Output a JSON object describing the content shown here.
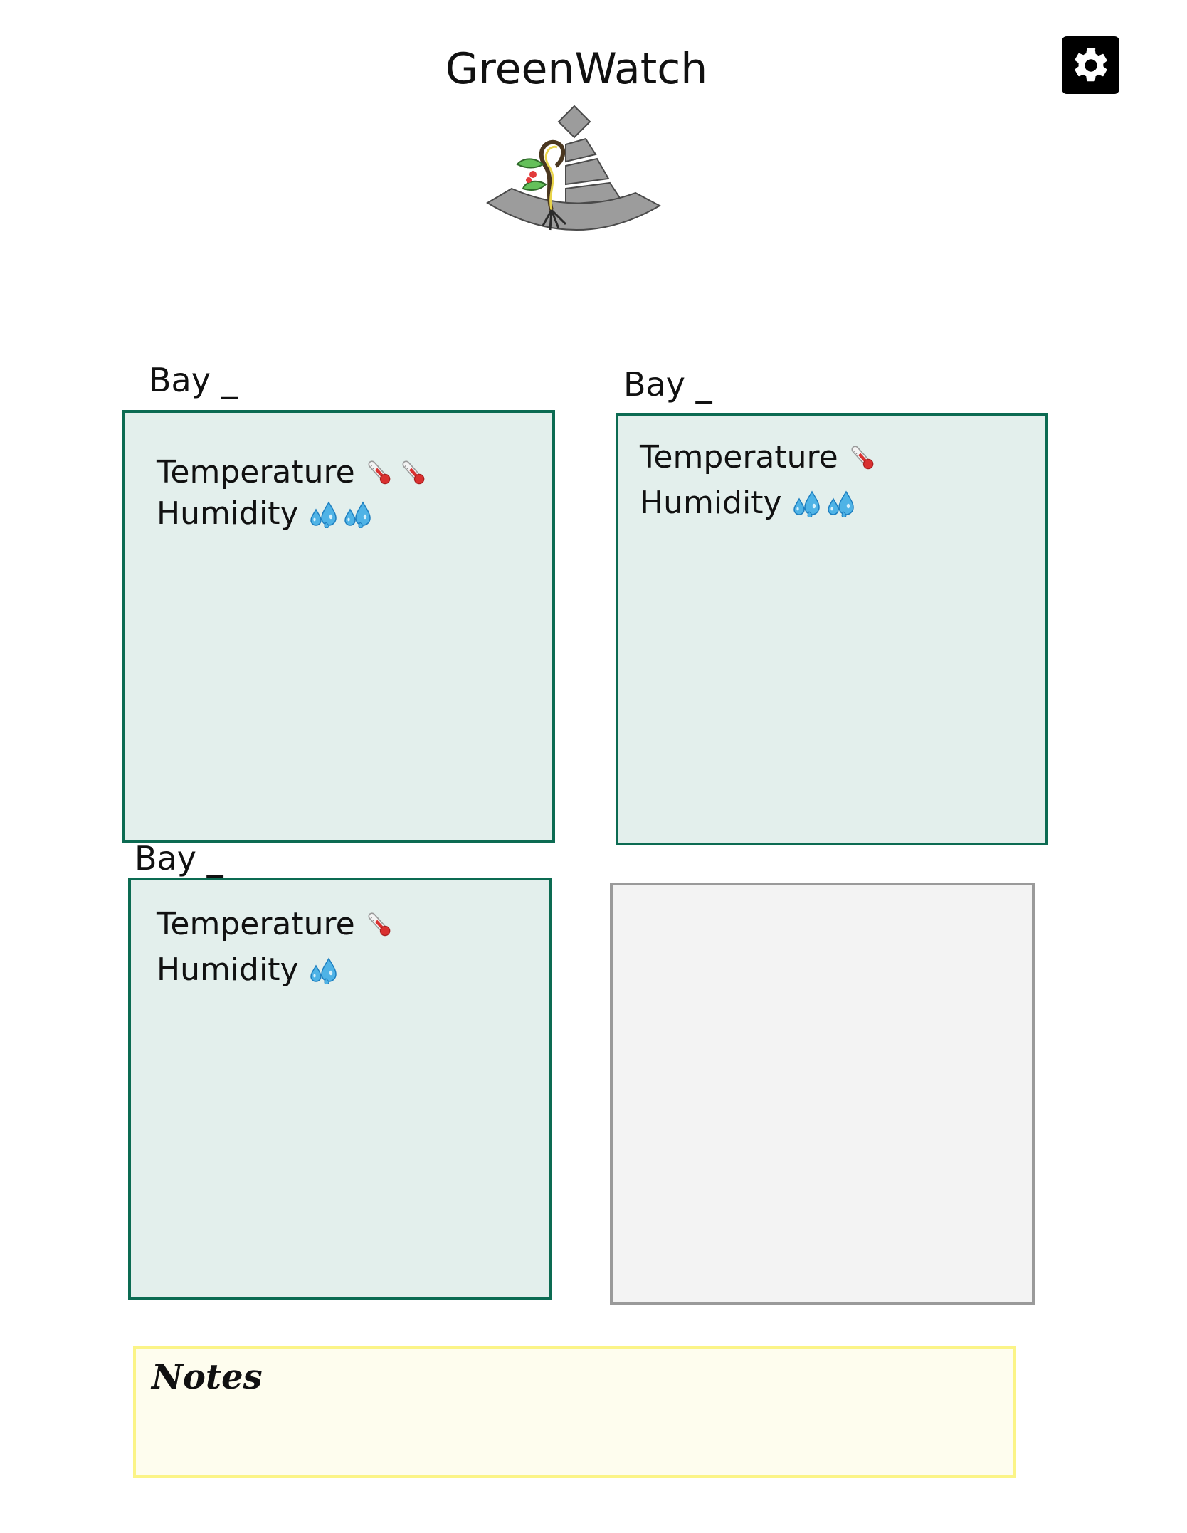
{
  "app": {
    "title": "GreenWatch"
  },
  "header": {
    "settings_icon": "gear-icon",
    "logo": "greenwatch-plant-logo"
  },
  "bays": [
    {
      "label": "Bay _",
      "temperature_label": "Temperature",
      "temperature_icon_count": 2,
      "humidity_label": "Humidity",
      "humidity_icon_count": 2
    },
    {
      "label": "Bay _",
      "temperature_label": "Temperature",
      "temperature_icon_count": 1,
      "humidity_label": "Humidity",
      "humidity_icon_count": 2
    },
    {
      "label": "Bay _",
      "temperature_label": "Temperature",
      "temperature_icon_count": 1,
      "humidity_label": "Humidity",
      "humidity_icon_count": 1
    }
  ],
  "empty_slot": {
    "state": "empty"
  },
  "notes": {
    "label": "Notes"
  },
  "colors": {
    "bay_border": "#0c6b52",
    "bay_fill": "#e3efec",
    "empty_border": "#9a9a9a",
    "empty_fill": "#f3f3f3",
    "notes_border": "#fbf487",
    "notes_fill": "#fefdee"
  },
  "icons": {
    "temperature": "thermometer-icon",
    "humidity": "water-droplets-icon"
  }
}
